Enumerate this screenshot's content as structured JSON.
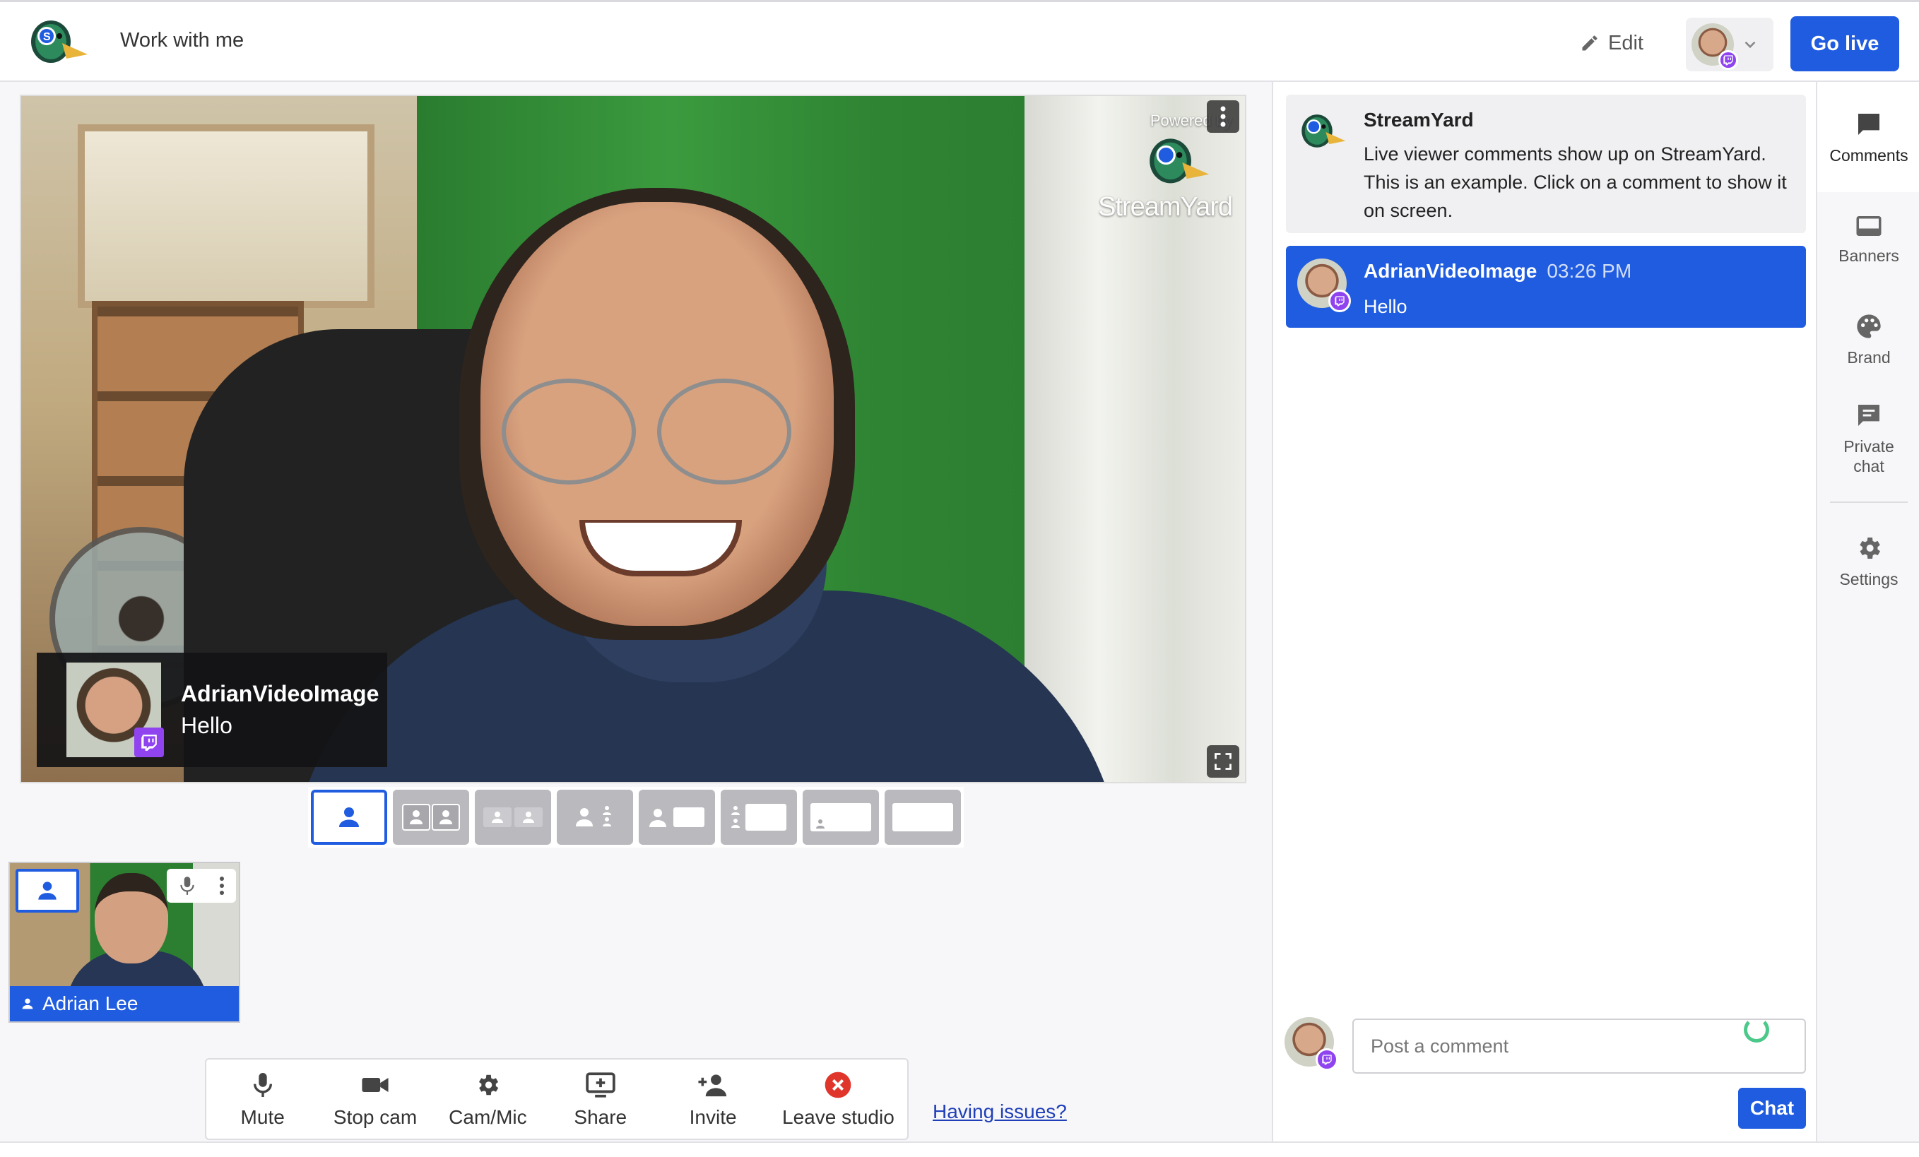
{
  "header": {
    "project_title": "Work with me",
    "edit_label": "Edit",
    "go_live_label": "Go live"
  },
  "stage": {
    "powered_by": "Powered by",
    "brand_name": "StreamYard",
    "overlay_comment": {
      "author": "AdrianVideoImage",
      "message": "Hello"
    }
  },
  "layouts": {
    "options": [
      "solo",
      "cropped",
      "group",
      "leader",
      "screen-side",
      "thin-side",
      "picture-in-picture",
      "fullscreen"
    ],
    "active": "solo"
  },
  "participant": {
    "name": "Adrian Lee"
  },
  "toolbar": {
    "mute": "Mute",
    "stop_cam": "Stop cam",
    "cam_mic": "Cam/Mic",
    "share": "Share",
    "invite": "Invite",
    "leave": "Leave studio",
    "having_issues": "Having issues?"
  },
  "comments": {
    "intro": {
      "author": "StreamYard",
      "body": "Live viewer comments show up on StreamYard. This is an example. Click on a comment to show it on screen."
    },
    "items": [
      {
        "author": "AdrianVideoImage",
        "time": "03:26 PM",
        "body": "Hello"
      }
    ],
    "input_placeholder": "Post a comment",
    "chat_label": "Chat"
  },
  "sidebar": {
    "comments": "Comments",
    "banners": "Banners",
    "brand": "Brand",
    "private_chat": "Private chat",
    "settings": "Settings"
  },
  "colors": {
    "accent": "#1f5ce0",
    "twitch": "#8f44f0",
    "leave": "#e0352b"
  }
}
